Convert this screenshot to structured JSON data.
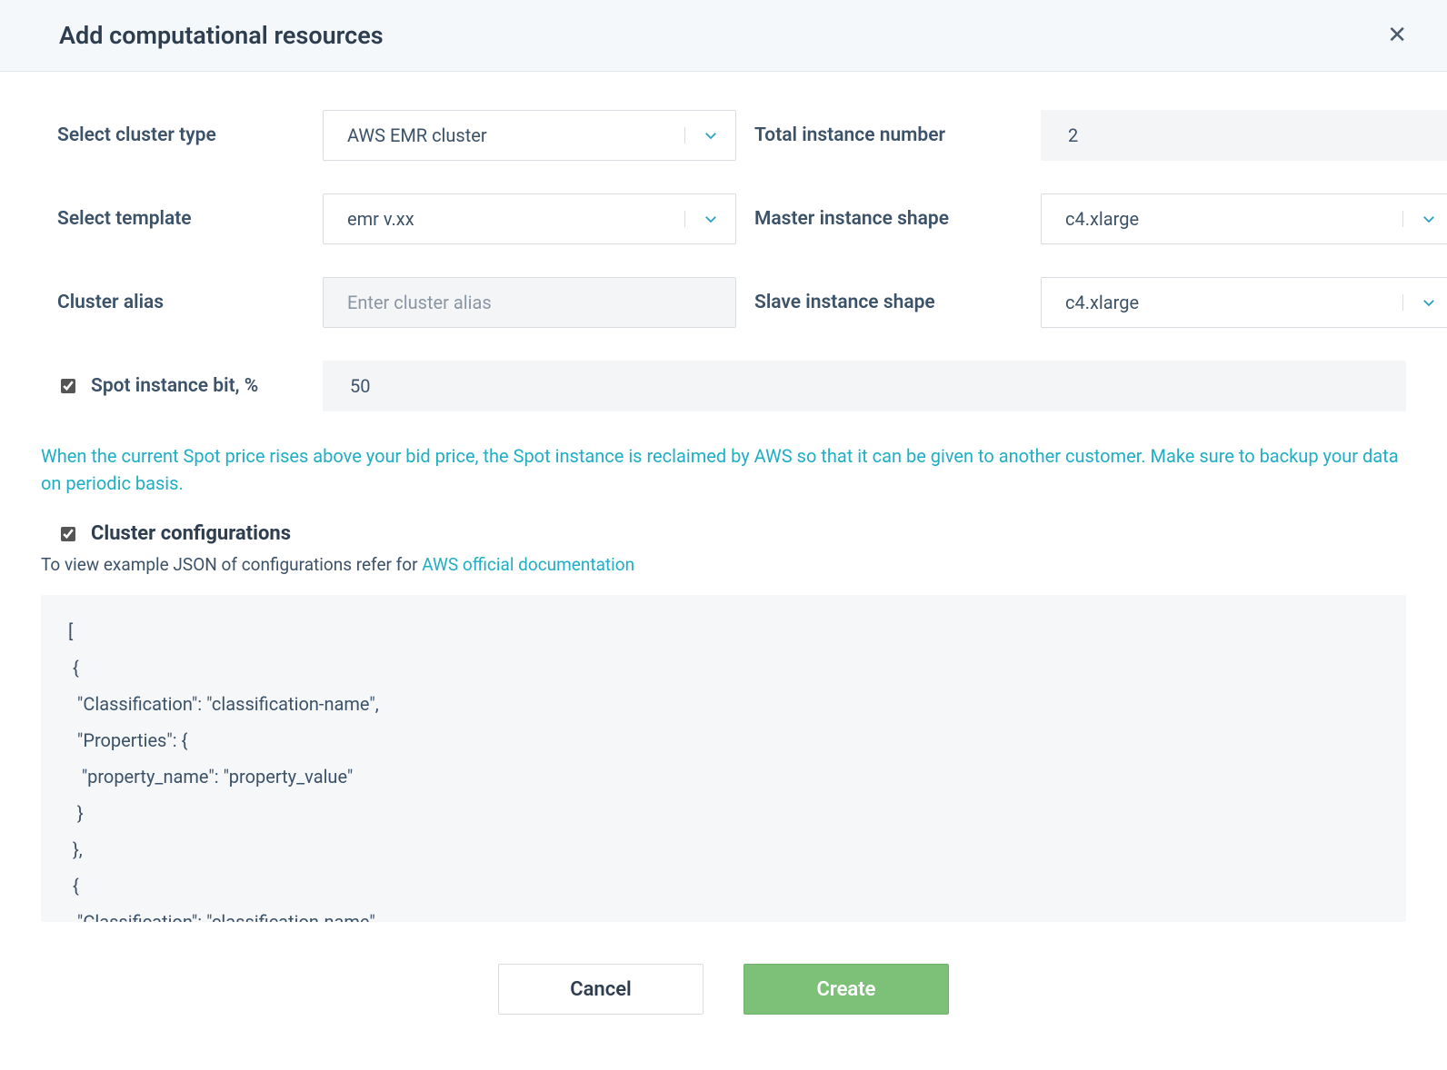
{
  "header": {
    "title": "Add computational resources"
  },
  "form": {
    "cluster_type_label": "Select cluster type",
    "cluster_type_value": "AWS EMR cluster",
    "total_instance_label": "Total instance number",
    "total_instance_value": "2",
    "template_label": "Select template",
    "template_value": "emr v.xx",
    "master_shape_label": "Master instance shape",
    "master_shape_value": "c4.xlarge",
    "alias_label": "Cluster alias",
    "alias_placeholder": "Enter cluster alias",
    "slave_shape_label": "Slave instance shape",
    "slave_shape_value": "c4.xlarge"
  },
  "spot": {
    "checked": true,
    "label": "Spot instance bit, %",
    "value": "50",
    "info": "When the current Spot price rises above your bid price, the Spot instance is reclaimed by AWS so that it can be given to another customer. Make sure to backup your data on periodic basis."
  },
  "cc": {
    "checked": true,
    "title": "Cluster configurations",
    "sub_prefix": "To view example JSON of configurations refer for ",
    "sub_link": "AWS official documentation",
    "config_text": "[\n {\n  \"Classification\": \"classification-name\",\n  \"Properties\": {\n   \"property_name\": \"property_value\"\n  }\n },\n {\n  \"Classification\": \"classification-name\","
  },
  "footer": {
    "cancel": "Cancel",
    "create": "Create"
  }
}
